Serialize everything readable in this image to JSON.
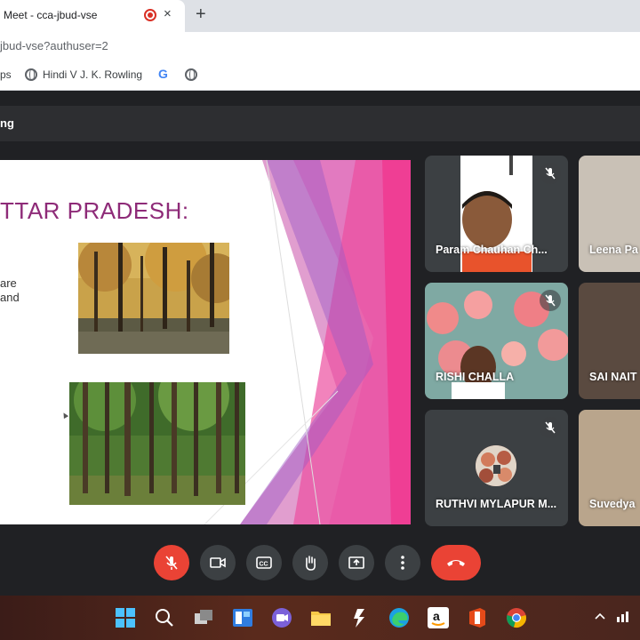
{
  "browser": {
    "tab_title": "Meet - cca-jbud-vse",
    "tab_close": "×",
    "new_tab": "+",
    "url": "jbud-vse?authuser=2",
    "bookmarks": [
      {
        "label": "ps",
        "icon": "globe-icon"
      },
      {
        "label": "Hindi V J. K. Rowling",
        "icon": "globe-icon"
      },
      {
        "label": "G",
        "icon": "google-icon"
      },
      {
        "label": "",
        "icon": "globe-icon"
      }
    ]
  },
  "meet": {
    "header_title": "ng",
    "presentation": {
      "title": "TTAR PRADESH:",
      "text_lines": [
        "are",
        "and"
      ]
    },
    "participants": [
      {
        "name": "Param Chauhan Ch...",
        "muted": true
      },
      {
        "name": "Leena Pa",
        "muted": false
      },
      {
        "name": "RISHI CHALLA",
        "muted": true
      },
      {
        "name": "SAI NAIT",
        "muted": false
      },
      {
        "name": "RUTHVI MYLAPUR M...",
        "muted": true
      },
      {
        "name": "Suvedya",
        "muted": false
      }
    ],
    "controls": [
      "mic-off-icon",
      "camera-icon",
      "captions-icon",
      "raise-hand-icon",
      "present-icon",
      "more-options-icon",
      "end-call-icon"
    ]
  },
  "taskbar": {
    "apps": [
      "windows-start-icon",
      "search-icon",
      "task-view-icon",
      "widgets-icon",
      "chat-icon",
      "file-explorer-icon",
      "edge-dev-icon",
      "edge-icon",
      "amazon-icon",
      "office-icon",
      "chrome-icon"
    ],
    "tray": [
      "chevron-up-icon",
      "network-icon"
    ]
  },
  "colors": {
    "slide_title": "#8e2b78",
    "accent_red": "#ea4335",
    "meet_bg": "#202124",
    "tile_bg": "#3c4043"
  }
}
